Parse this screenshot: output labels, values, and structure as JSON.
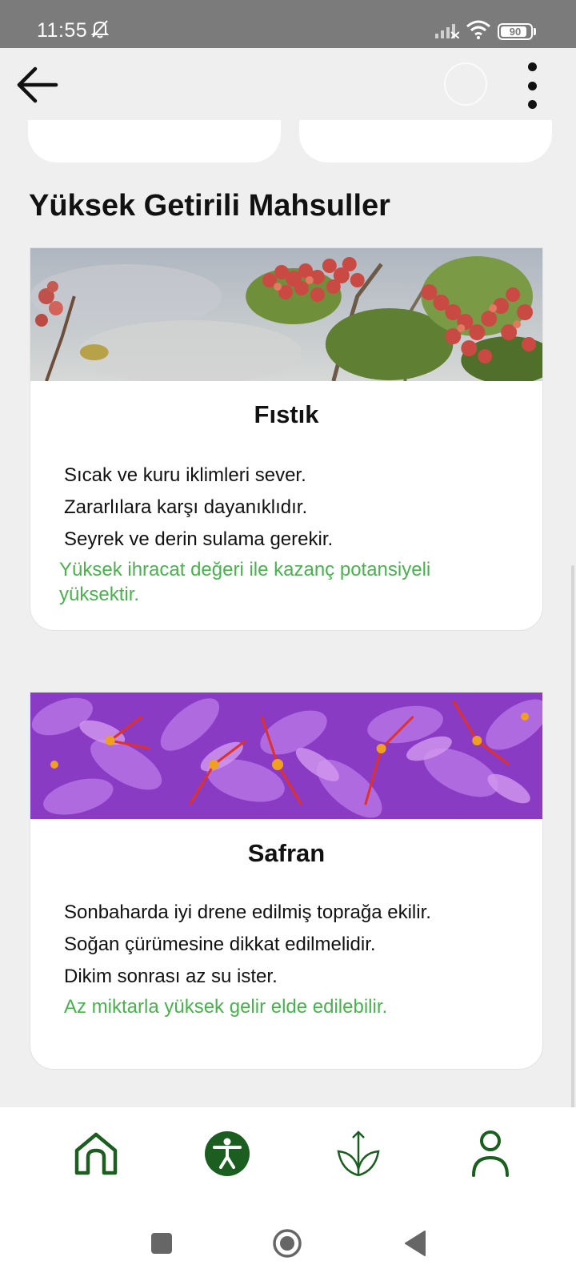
{
  "status_bar": {
    "time": "11:55",
    "battery": "90",
    "battery_level": 0.9
  },
  "icons": {
    "back": "arrow-left-icon",
    "menu": "more-vert-icon",
    "nav_home": "home-icon",
    "nav_accessibility": "accessibility-icon",
    "nav_plant": "plant-growth-icon",
    "nav_profile": "person-icon"
  },
  "colors": {
    "accent_green": "#4caf50",
    "nav_green": "#1b5e20",
    "status_bar": "#7b7b7b",
    "background": "#efefef"
  },
  "section": {
    "title": "Yüksek Getirili Mahsuller"
  },
  "crops": [
    {
      "name": "Fıstık",
      "lines": [
        "Sıcak ve kuru iklimleri sever.",
        "Zararlılara karşı dayanıklıdır.",
        "Seyrek ve derin sulama gerekir."
      ],
      "highlight": "Yüksek ihracat değeri ile kazanç potansiyeli yüksektir."
    },
    {
      "name": "Safran",
      "lines": [
        "Sonbaharda iyi drene edilmiş toprağa ekilir.",
        "Soğan çürümesine dikkat edilmelidir.",
        "Dikim sonrası az su ister."
      ],
      "highlight": "Az miktarla yüksek gelir elde edilebilir."
    }
  ]
}
